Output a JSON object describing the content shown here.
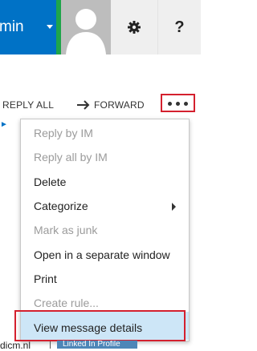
{
  "header": {
    "account_label": "min",
    "help_label": "?"
  },
  "toolbar": {
    "reply_all_label": "REPLY ALL",
    "forward_label": "FORWARD"
  },
  "context_menu": {
    "items": [
      {
        "label": "Reply by IM",
        "enabled": false
      },
      {
        "label": "Reply all by IM",
        "enabled": false
      },
      {
        "label": "Delete",
        "enabled": true
      },
      {
        "label": "Categorize",
        "enabled": true,
        "has_submenu": true
      },
      {
        "label": "Mark as junk",
        "enabled": false
      },
      {
        "label": "Open in a separate window",
        "enabled": true
      },
      {
        "label": "Print",
        "enabled": true
      },
      {
        "label": "Create rule...",
        "enabled": false
      },
      {
        "label": "View message details",
        "enabled": true,
        "highlighted": true
      }
    ]
  },
  "background": {
    "left_fragment": "dicm.nl",
    "badge_label": "Linked In Profile"
  },
  "colors": {
    "brand_blue": "#0072c6",
    "presence_green": "#1ea54a",
    "annotation_red": "#d4202e",
    "highlight_blue": "#cde6f7"
  }
}
